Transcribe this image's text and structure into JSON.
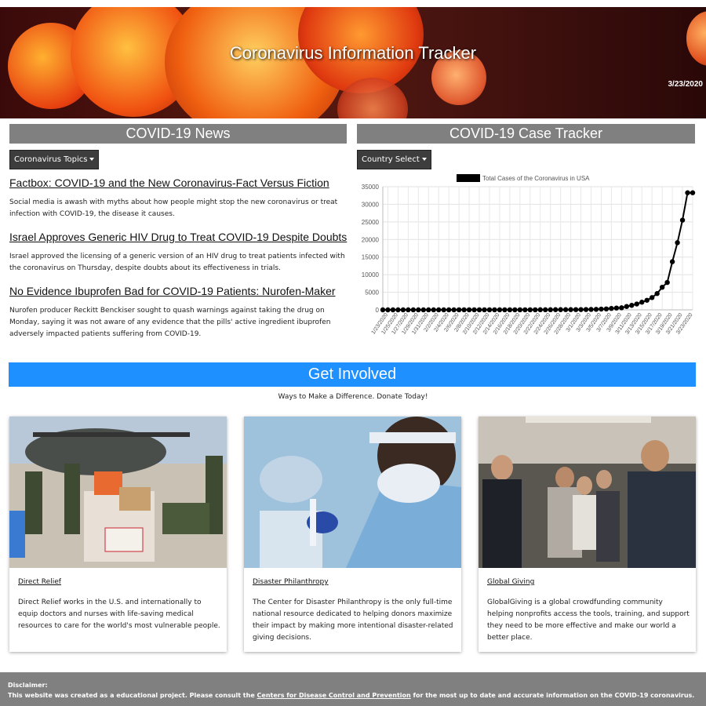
{
  "header": {
    "title": "Coronavirus Information Tracker",
    "date": "3/23/2020"
  },
  "news": {
    "section_title": "COVID-19 News",
    "dropdown_label": "Coronavirus Topics",
    "articles": [
      {
        "title": "Factbox: COVID-19 and the New Coronavirus-Fact Versus Fiction",
        "body": "Social media is awash with myths about how people might stop the new coronavirus or treat infection with COVID-19, the disease it causes."
      },
      {
        "title": "Israel Approves Generic HIV Drug to Treat COVID-19 Despite Doubts",
        "body": "Israel approved the licensing of a generic version of an HIV drug to treat patients infected with the coronavirus on Thursday, despite doubts about its effectiveness in trials."
      },
      {
        "title": "No Evidence Ibuprofen Bad for COVID-19 Patients: Nurofen-Maker",
        "body": "Nurofen producer Reckitt Benckiser sought to quash warnings against taking the drug on Monday, saying it was not aware of any evidence that the pills' active ingredient ibuprofen adversely impacted patients suffering from COVID-19."
      }
    ]
  },
  "tracker": {
    "section_title": "COVID-19 Case Tracker",
    "dropdown_label": "Country Select"
  },
  "chart_data": {
    "type": "line",
    "legend": "Total Cases of the Coronavirus in USA",
    "legend_position": "top",
    "grid": true,
    "ylim": [
      0,
      35000
    ],
    "yticks": [
      0,
      5000,
      10000,
      15000,
      20000,
      25000,
      30000,
      35000
    ],
    "x": [
      "1/22/2020",
      "1/23/2020",
      "1/24/2020",
      "1/25/2020",
      "1/26/2020",
      "1/27/2020",
      "1/28/2020",
      "1/29/2020",
      "1/30/2020",
      "1/31/2020",
      "2/1/2020",
      "2/2/2020",
      "2/3/2020",
      "2/4/2020",
      "2/5/2020",
      "2/6/2020",
      "2/7/2020",
      "2/8/2020",
      "2/9/2020",
      "2/10/2020",
      "2/11/2020",
      "2/12/2020",
      "2/13/2020",
      "2/14/2020",
      "2/15/2020",
      "2/16/2020",
      "2/17/2020",
      "2/18/2020",
      "2/19/2020",
      "2/20/2020",
      "2/21/2020",
      "2/22/2020",
      "2/23/2020",
      "2/24/2020",
      "2/25/2020",
      "2/26/2020",
      "2/27/2020",
      "2/28/2020",
      "2/29/2020",
      "3/1/2020",
      "3/2/2020",
      "3/3/2020",
      "3/4/2020",
      "3/5/2020",
      "3/6/2020",
      "3/7/2020",
      "3/8/2020",
      "3/9/2020",
      "3/10/2020",
      "3/11/2020",
      "3/12/2020",
      "3/13/2020",
      "3/14/2020",
      "3/15/2020",
      "3/16/2020",
      "3/17/2020",
      "3/18/2020",
      "3/19/2020",
      "3/20/2020",
      "3/21/2020",
      "3/22/2020",
      "3/23/2020"
    ],
    "values": [
      1,
      1,
      2,
      2,
      5,
      5,
      5,
      5,
      5,
      6,
      8,
      8,
      11,
      11,
      11,
      12,
      12,
      12,
      12,
      12,
      13,
      13,
      15,
      15,
      15,
      15,
      15,
      15,
      15,
      15,
      15,
      35,
      35,
      35,
      53,
      57,
      60,
      60,
      68,
      74,
      98,
      118,
      149,
      217,
      262,
      402,
      518,
      583,
      959,
      1281,
      1663,
      2179,
      2727,
      3499,
      4632,
      6421,
      7786,
      13680,
      19101,
      25493,
      33276,
      33276
    ],
    "xtick_labels": [
      "1/23/2020",
      "1/25/2020",
      "1/27/2020",
      "1/29/2020",
      "1/31/2020",
      "2/2/2020",
      "2/4/2020",
      "2/6/2020",
      "2/8/2020",
      "2/10/2020",
      "2/12/2020",
      "2/14/2020",
      "2/16/2020",
      "2/18/2020",
      "2/20/2020",
      "2/22/2020",
      "2/24/2020",
      "2/26/2020",
      "2/28/2020",
      "3/1/2020",
      "3/3/2020",
      "3/5/2020",
      "3/7/2020",
      "3/9/2020",
      "3/11/2020",
      "3/13/2020",
      "3/15/2020",
      "3/17/2020",
      "3/19/2020",
      "3/21/2020",
      "3/23/2020"
    ],
    "color": "#000000"
  },
  "involved": {
    "title": "Get Involved",
    "subtitle": "Ways to Make a Difference. Donate Today!",
    "cards": [
      {
        "link": "Direct Relief",
        "body": "Direct Relief works in the U.S. and internationally to equip doctors and nurses with life-saving medical resources to care for the world's most vulnerable people."
      },
      {
        "link": "Disaster Philanthropy",
        "body": "The Center for Disaster Philanthropy is the only full-time national resource dedicated to helping donors maximize their impact by making more intentional disaster-related giving decisions."
      },
      {
        "link": "Global Giving",
        "body": "GlobalGiving is a global crowdfunding community helping nonprofits access the tools, training, and support they need to be more effective and make our world a better place."
      }
    ]
  },
  "footer": {
    "heading": "Disclaimer:",
    "text_before": "This website was created as a educational project. Please consult the ",
    "link": "Centers for Disease Control and Prevention",
    "text_after": " for the most up to date and accurate information on the COVID-19 coronavirus."
  },
  "colors": {
    "section_gray": "#808080",
    "accent_blue": "#1e90ff",
    "dropdown_dark": "#3d3d3d"
  }
}
